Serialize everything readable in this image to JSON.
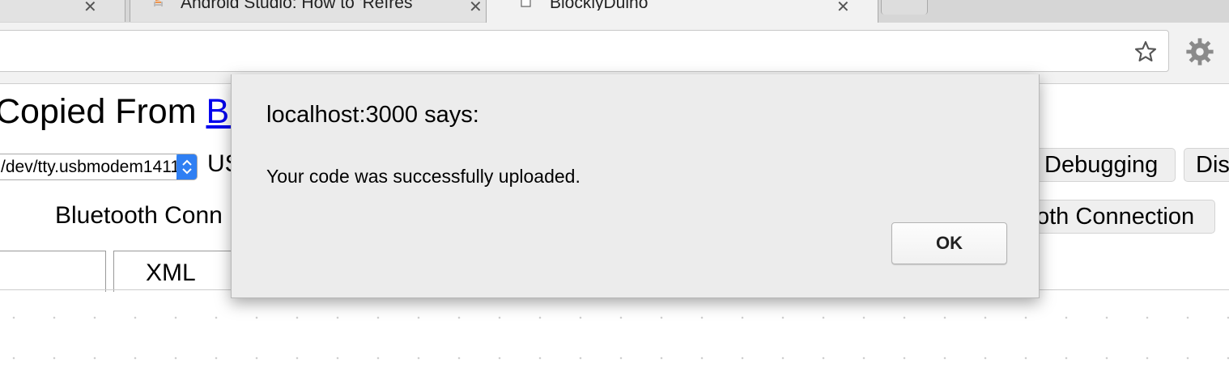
{
  "browser": {
    "tabs": [
      {
        "title": "Android Studio: How to 'Refres",
        "favicon": "stackoverflow-icon"
      },
      {
        "title": "BlocklyDuino",
        "favicon": "page-icon"
      }
    ],
    "toolbar": {
      "bookmark_icon": "star-icon",
      "extension_icon": "gear-icon"
    }
  },
  "page": {
    "heading_prefix": "Copied From ",
    "heading_link": "Bl",
    "port_select_value": "/dev/tty.usbmodem1411",
    "usb_label": "US",
    "debug_button": "Debugging",
    "dis_button": "Dis",
    "bluetooth_label": "Bluetooth Conn",
    "bluetooth_button": "oth Connection",
    "xml_tab": "XML"
  },
  "dialog": {
    "title": "localhost:3000 says:",
    "message": "Your code was successfully uploaded.",
    "ok_label": "OK"
  },
  "colors": {
    "link": "#0000ee",
    "select_accent": "#1e6ff0",
    "favicon_orange": "#f48024"
  }
}
